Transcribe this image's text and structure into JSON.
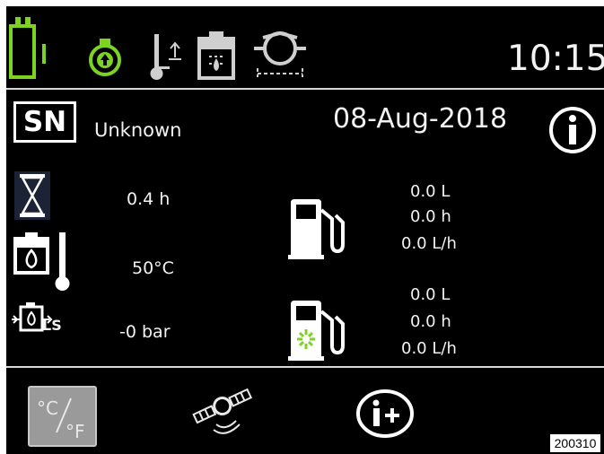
{
  "header": {
    "time": "10:15",
    "status_icons": [
      "battery-icon",
      "engine-oil-pressure-icon",
      "coolant-temperature-icon",
      "hydraulic-oil-icon",
      "hydraulic-pump-icon"
    ],
    "accent_color": "#7dd321"
  },
  "info": {
    "serial_label": "SN",
    "serial_value": "Unknown",
    "date": "08-Aug-2018"
  },
  "gauges": {
    "hours": "0.4 h",
    "oil_temperature": "50°C",
    "pressure": "-0 bar",
    "pressure_sublabel": "LS"
  },
  "fuel": {
    "trip": {
      "volume": "0.0 L",
      "time": "0.0 h",
      "rate": "0.0 L/h"
    },
    "idle": {
      "volume": "0.0 L",
      "time": "0.0 h",
      "rate": "0.0 L/h"
    }
  },
  "bottom_bar": {
    "unit_toggle_label": "°C/°F",
    "buttons": [
      "unit-toggle-button",
      "telematics-button",
      "info-plus-button"
    ]
  },
  "figure_id": "200310"
}
